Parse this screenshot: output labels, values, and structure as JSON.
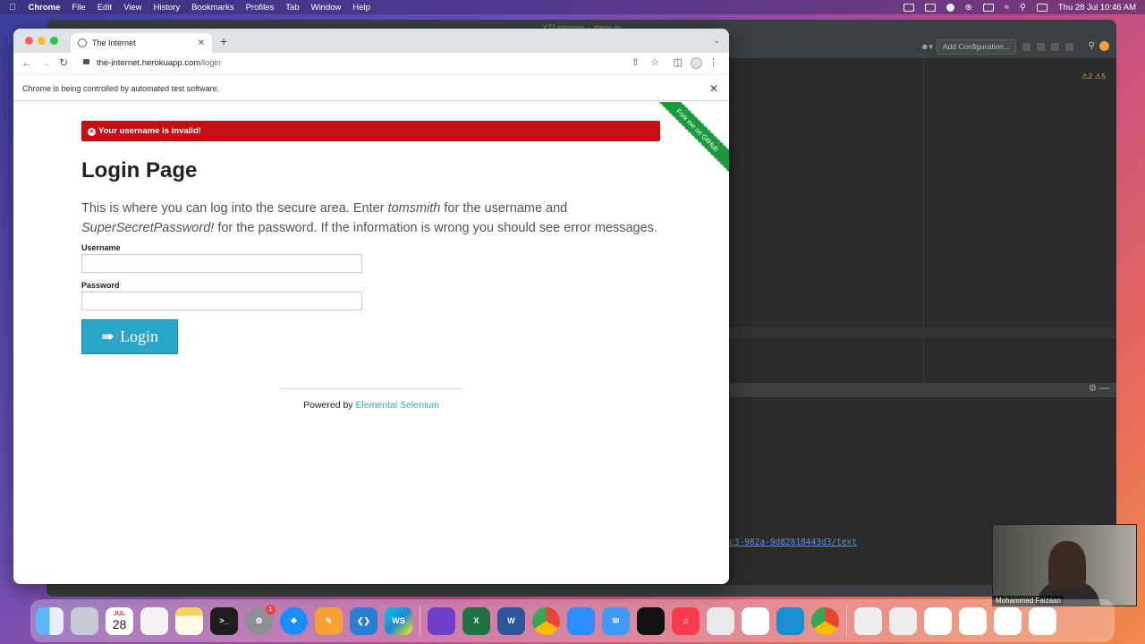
{
  "menubar": {
    "app": "Chrome",
    "items": [
      "File",
      "Edit",
      "View",
      "History",
      "Bookmarks",
      "Profiles",
      "Tab",
      "Window",
      "Help"
    ],
    "datetime": "Thu 28 Jul  10:46 AM"
  },
  "ide": {
    "title": "XTLearning – steps.js",
    "run_config": "Add Configuration...",
    "warnings": "⚠2 ⚠5",
    "console_link": "c3-982a-9d82818443d3/text"
  },
  "chrome": {
    "tab_title": "The Internet",
    "url_host": "the-internet.herokuapp.com",
    "url_path": "/login",
    "infobar_text": "Chrome is being controlled by automated test software."
  },
  "page": {
    "flash_message": "Your username is invalid!",
    "fork_ribbon": "Fork me on GitHub",
    "heading": "Login Page",
    "desc_part1": "This is where you can log into the secure area. Enter ",
    "desc_user": "tomsmith",
    "desc_part2": " for the username and ",
    "desc_pass": "SuperSecretPassword!",
    "desc_part3": " for the password. If the information is wrong you should see error messages.",
    "username_label": "Username",
    "username_value": "",
    "password_label": "Password",
    "password_value": "",
    "login_button": "Login",
    "footer_prefix": "Powered by ",
    "footer_link": "Elemental Selenium"
  },
  "dock": {
    "calendar_month": "JUL",
    "calendar_day": "28",
    "settings_badge": "1",
    "webstorm_label": "WS",
    "apps": [
      "finder",
      "launchpad",
      "calendar",
      "reminders",
      "notes",
      "terminal",
      "system-preferences",
      "safari",
      "pages",
      "vscode",
      "webstorm",
      "github-desktop",
      "excel",
      "word",
      "chrome",
      "zoom",
      "mail",
      "activity-monitor",
      "music",
      "script-editor",
      "slack",
      "screen-sharing",
      "chrome-canary"
    ]
  },
  "webcam": {
    "name": "Mohammed Faizaan"
  },
  "colors": {
    "flash_bg": "#c60f13",
    "button_bg": "#2ba6cb",
    "link": "#2ba6cb",
    "ribbon": "#1a9a3a"
  }
}
